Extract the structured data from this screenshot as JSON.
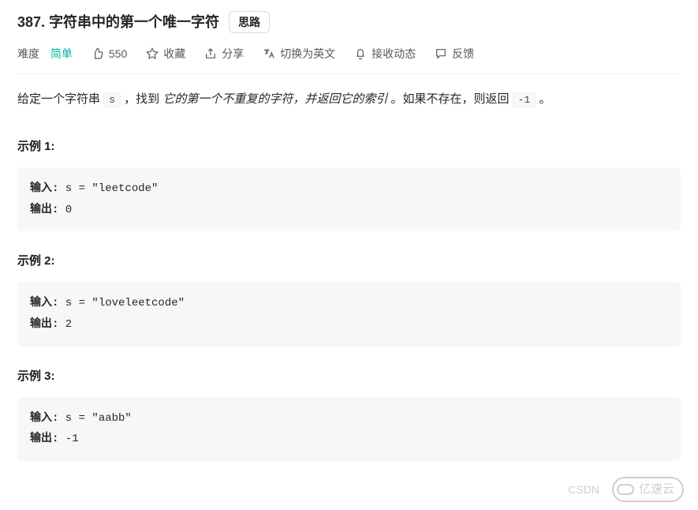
{
  "header": {
    "number": "387.",
    "title": "字符串中的第一个唯一字符",
    "hint_button": "思路"
  },
  "toolbar": {
    "difficulty_label": "难度",
    "difficulty_value": "简单",
    "likes": "550",
    "favorite": "收藏",
    "share": "分享",
    "translate": "切换为英文",
    "subscribe": "接收动态",
    "feedback": "反馈"
  },
  "description": {
    "part1": "给定一个字符串 ",
    "code1": "s",
    "part2": " ，找到 ",
    "italic": "它的第一个不重复的字符，并返回它的索引",
    "part3": " 。如果不存在，则返回 ",
    "code2": "-1",
    "part4": " 。"
  },
  "examples": [
    {
      "title": "示例 1:",
      "input_label": "输入:",
      "input_value": " s = \"leetcode\"",
      "output_label": "输出:",
      "output_value": " 0"
    },
    {
      "title": "示例 2:",
      "input_label": "输入:",
      "input_value": " s = \"loveleetcode\"",
      "output_label": "输出:",
      "output_value": " 2"
    },
    {
      "title": "示例 3:",
      "input_label": "输入:",
      "input_value": " s = \"aabb\"",
      "output_label": "输出:",
      "output_value": " -1"
    }
  ],
  "watermark": {
    "text1": "CSDN",
    "text2": "亿速云"
  }
}
